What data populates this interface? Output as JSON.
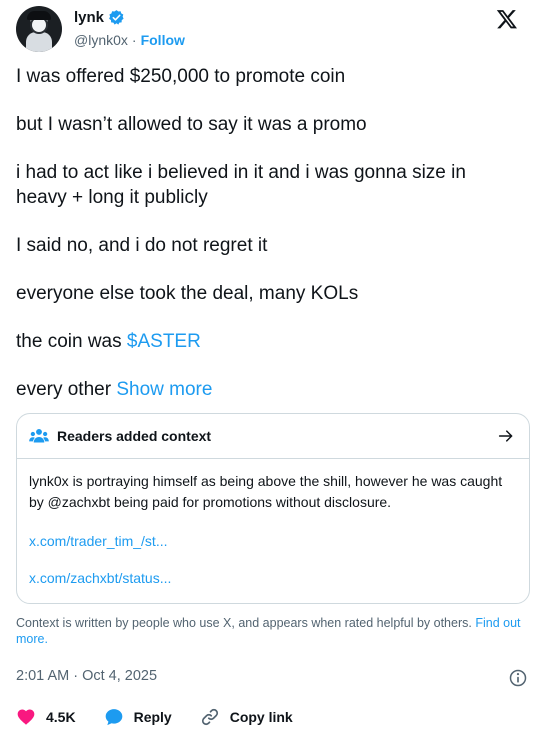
{
  "author": {
    "display_name": "lynk",
    "handle": "@lynk0x",
    "separator": "·",
    "follow_label": "Follow"
  },
  "tweet": {
    "paragraphs": [
      "I was offered $250,000 to promote coin",
      "but I wasn’t allowed to say it was a promo",
      "i had to act like i believed in it and i was gonna size in heavy + long it publicly",
      "I said no, and i do not regret it",
      "everyone else took the deal, many KOLs"
    ],
    "coin_prefix": "the coin was ",
    "coin_tag": "$ASTER",
    "truncated_text": "every other ",
    "show_more_label": "Show more"
  },
  "community_note": {
    "title": "Readers added context",
    "body": "lynk0x is portraying himself as being above the shill, however he was caught by @zachxbt being paid for promotions without disclosure.",
    "links": [
      "x.com/trader_tim_/st...",
      "x.com/zachxbt/status..."
    ]
  },
  "context_footer": {
    "text": "Context is written by people who use X, and appears when rated helpful by others.",
    "link_label": "Find out more."
  },
  "timestamp": "2:01 AM · Oct 4, 2025",
  "actions": {
    "like_count": "4.5K",
    "reply_label": "Reply",
    "copy_link_label": "Copy link"
  },
  "colors": {
    "accent": "#1d9bf0",
    "like": "#f91880",
    "muted": "#536471",
    "border": "#cfd9de"
  },
  "icons": [
    "verified-badge-icon",
    "x-logo-icon",
    "people-icon",
    "arrow-right-icon",
    "info-icon",
    "heart-icon",
    "reply-icon",
    "link-icon"
  ]
}
